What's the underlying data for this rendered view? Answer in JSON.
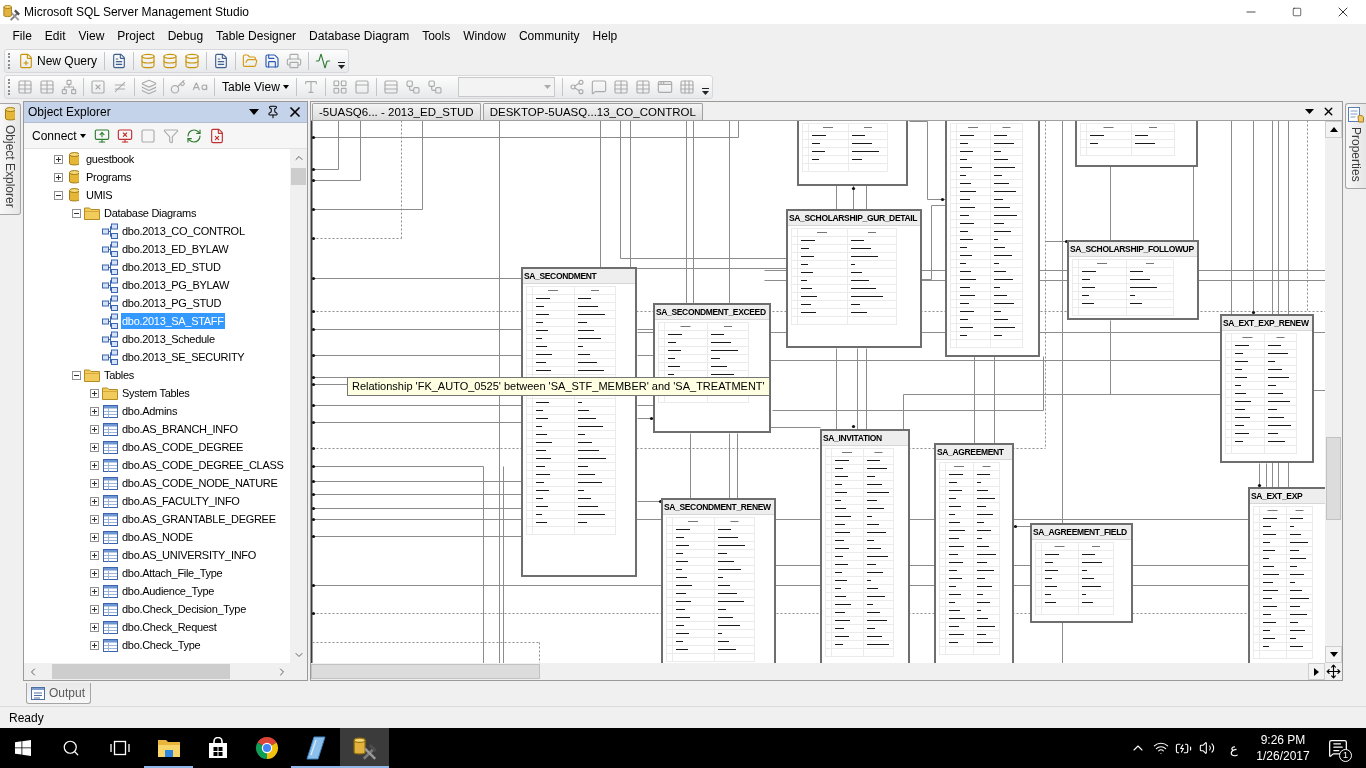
{
  "window": {
    "title": "Microsoft SQL Server Management Studio"
  },
  "menu": [
    "File",
    "Edit",
    "View",
    "Project",
    "Debug",
    "Table Designer",
    "Database Diagram",
    "Tools",
    "Window",
    "Community",
    "Help"
  ],
  "toolbars": [
    {
      "items": [
        {
          "kind": "new_query",
          "label": "New Query"
        },
        {
          "kind": "separator"
        },
        {
          "kind": "document",
          "disabled": false
        },
        {
          "kind": "separator"
        },
        {
          "kind": "database",
          "disabled": false
        },
        {
          "kind": "database",
          "disabled": false
        },
        {
          "kind": "database",
          "disabled": false
        },
        {
          "kind": "separator"
        },
        {
          "kind": "document",
          "disabled": false
        },
        {
          "kind": "separator"
        },
        {
          "kind": "open",
          "disabled": false
        },
        {
          "kind": "save",
          "disabled": false
        },
        {
          "kind": "print",
          "disabled": true
        },
        {
          "kind": "separator"
        },
        {
          "kind": "monitor",
          "disabled": false
        },
        {
          "kind": "overflow"
        }
      ]
    },
    {
      "items": [
        {
          "kind": "table",
          "disabled": true
        },
        {
          "kind": "table",
          "disabled": true
        },
        {
          "kind": "relation",
          "disabled": true
        },
        {
          "kind": "separator"
        },
        {
          "kind": "delete",
          "disabled": true
        },
        {
          "kind": "not_equal",
          "disabled": true
        },
        {
          "kind": "separator"
        },
        {
          "kind": "layers",
          "disabled": true
        },
        {
          "kind": "separator"
        },
        {
          "kind": "key",
          "disabled": true
        },
        {
          "kind": "text",
          "disabled": true
        },
        {
          "kind": "separator"
        },
        {
          "kind": "dropdown",
          "label": "Table View"
        },
        {
          "kind": "separator"
        },
        {
          "kind": "font",
          "disabled": true
        },
        {
          "kind": "separator"
        },
        {
          "kind": "layout",
          "disabled": true
        },
        {
          "kind": "page",
          "disabled": true
        },
        {
          "kind": "separator"
        },
        {
          "kind": "rows",
          "disabled": true
        },
        {
          "kind": "workflow",
          "disabled": true
        },
        {
          "kind": "workflow",
          "disabled": true
        },
        {
          "kind": "combo",
          "disabled": true
        },
        {
          "kind": "separator"
        },
        {
          "kind": "share",
          "disabled": true
        },
        {
          "kind": "note",
          "disabled": true
        },
        {
          "kind": "table",
          "disabled": true
        },
        {
          "kind": "table",
          "disabled": true
        },
        {
          "kind": "window",
          "disabled": true
        },
        {
          "kind": "grid",
          "disabled": true
        },
        {
          "kind": "overflow"
        }
      ]
    }
  ],
  "left_side_tabs": [
    {
      "label": "Object Explorer"
    }
  ],
  "object_explorer": {
    "title": "Object Explorer",
    "connect": "Connect",
    "tools": [
      {
        "kind": "connect",
        "disabled": false
      },
      {
        "kind": "disconnect",
        "disabled": false
      },
      {
        "kind": "stop",
        "disabled": true
      },
      {
        "kind": "filter",
        "disabled": true
      },
      {
        "kind": "refresh",
        "disabled": false
      },
      {
        "kind": "cancel_script",
        "disabled": false
      }
    ],
    "tree": [
      {
        "label": "guestbook",
        "kind": "database",
        "expanded": false,
        "selected": false
      },
      {
        "label": "Programs",
        "kind": "database",
        "expanded": false,
        "selected": false
      },
      {
        "label": "UMIS",
        "kind": "database",
        "expanded": true,
        "selected": false,
        "children": [
          {
            "label": "Database Diagrams",
            "kind": "folder",
            "expanded": true,
            "selected": false,
            "children": [
              {
                "label": "dbo.2013_CO_CONTROL",
                "kind": "diagram",
                "selected": false
              },
              {
                "label": "dbo.2013_ED_BYLAW",
                "kind": "diagram",
                "selected": false
              },
              {
                "label": "dbo.2013_ED_STUD",
                "kind": "diagram",
                "selected": false
              },
              {
                "label": "dbo.2013_PG_BYLAW",
                "kind": "diagram",
                "selected": false
              },
              {
                "label": "dbo.2013_PG_STUD",
                "kind": "diagram",
                "selected": false
              },
              {
                "label": "dbo.2013_SA_STAFF",
                "kind": "diagram",
                "selected": true
              },
              {
                "label": "dbo.2013_Schedule",
                "kind": "diagram",
                "selected": false
              },
              {
                "label": "dbo.2013_SE_SECURITY",
                "kind": "diagram",
                "selected": false
              }
            ]
          },
          {
            "label": "Tables",
            "kind": "folder",
            "expanded": true,
            "selected": false,
            "children": [
              {
                "label": "System Tables",
                "kind": "folder",
                "expanded": false,
                "selected": false
              },
              {
                "label": "dbo.Admins",
                "kind": "table",
                "expanded": false,
                "selected": false
              },
              {
                "label": "dbo.AS_BRANCH_INFO",
                "kind": "table",
                "expanded": false,
                "selected": false
              },
              {
                "label": "dbo.AS_CODE_DEGREE",
                "kind": "table",
                "expanded": false,
                "selected": false
              },
              {
                "label": "dbo.AS_CODE_DEGREE_CLASS",
                "kind": "table",
                "expanded": false,
                "selected": false
              },
              {
                "label": "dbo.AS_CODE_NODE_NATURE",
                "kind": "table",
                "expanded": false,
                "selected": false
              },
              {
                "label": "dbo.AS_FACULTY_INFO",
                "kind": "table",
                "expanded": false,
                "selected": false
              },
              {
                "label": "dbo.AS_GRANTABLE_DEGREE",
                "kind": "table",
                "expanded": false,
                "selected": false
              },
              {
                "label": "dbo.AS_NODE",
                "kind": "table",
                "expanded": false,
                "selected": false
              },
              {
                "label": "dbo.AS_UNIVERSITY_INFO",
                "kind": "table",
                "expanded": false,
                "selected": false
              },
              {
                "label": "dbo.Attach_File_Type",
                "kind": "table",
                "expanded": false,
                "selected": false
              },
              {
                "label": "dbo.Audience_Type",
                "kind": "table",
                "expanded": false,
                "selected": false
              },
              {
                "label": "dbo.Check_Decision_Type",
                "kind": "table",
                "expanded": false,
                "selected": false
              },
              {
                "label": "dbo.Check_Request",
                "kind": "table",
                "expanded": false,
                "selected": false
              },
              {
                "label": "dbo.Check_Type",
                "kind": "table",
                "expanded": false,
                "selected": false
              }
            ]
          }
        ]
      }
    ]
  },
  "document": {
    "tabs": [
      {
        "label": "-5UASQ6... - 2013_ED_STUD",
        "selected": false
      },
      {
        "label": "DESKTOP-5UASQ...13_CO_CONTROL",
        "selected": false
      }
    ],
    "diagram": {
      "tables": [
        {
          "title": "SA_SCHOLARSHIP_GUR_DETAIL"
        },
        {
          "title": "SA_SCHOLARSHIP_FOLLOWUP"
        },
        {
          "title": "SA_SECONDMENT"
        },
        {
          "title": "SA_SECONDMENT_EXCEED"
        },
        {
          "title": "SA_EXT_EXP_RENEW"
        },
        {
          "title": "SA_INVITATION"
        },
        {
          "title": "SA_AGREEMENT"
        },
        {
          "title": "SA_EXT_EXP"
        },
        {
          "title": "SA_SECONDMENT_RENEW"
        },
        {
          "title": "SA_AGREEMENT_FIELD"
        }
      ],
      "tooltip": "Relationship 'FK_AUTO_0525' between 'SA_STF_MEMBER' and 'SA_TREATMENT'"
    }
  },
  "right_side_tabs": [
    {
      "label": "Properties"
    }
  ],
  "bottom_tabs": [
    {
      "label": "Output"
    }
  ],
  "status_bar": {
    "text": "Ready"
  },
  "taskbar": {
    "apps": [
      {
        "kind": "start",
        "running": false,
        "active": false
      },
      {
        "kind": "search",
        "running": false,
        "active": false
      },
      {
        "kind": "task_view",
        "running": false,
        "active": false
      },
      {
        "kind": "file_explorer",
        "running": true,
        "active": false
      },
      {
        "kind": "store",
        "running": false,
        "active": false
      },
      {
        "kind": "browser",
        "running": false,
        "active": false
      },
      {
        "kind": "notebook",
        "running": true,
        "active": false
      },
      {
        "kind": "database_tools",
        "running": true,
        "active": true
      }
    ],
    "tray": {
      "language": "ع",
      "time": "9:26 PM",
      "date": "1/26/2017",
      "notification_count": "1"
    }
  }
}
